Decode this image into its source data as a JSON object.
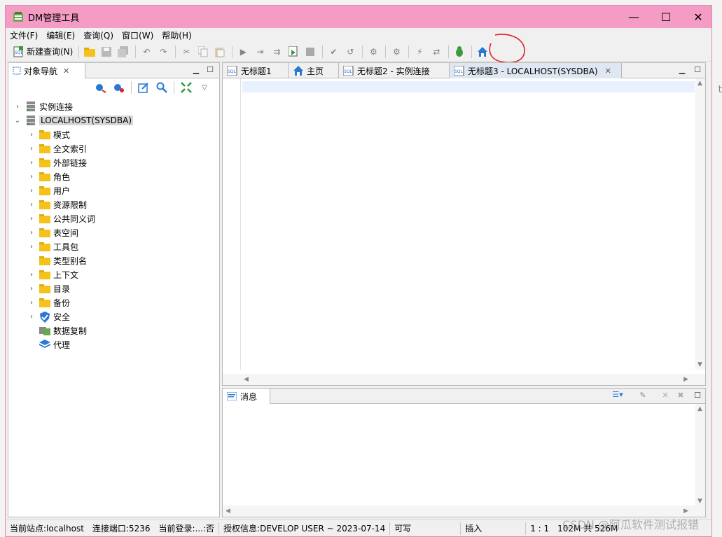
{
  "window": {
    "title": "DM管理工具",
    "minimize": "—",
    "maximize": "☐",
    "close": "✕"
  },
  "menu": [
    "文件(F)",
    "编辑(E)",
    "查询(Q)",
    "窗口(W)",
    "帮助(H)"
  ],
  "toolbar": {
    "new_query": "新建查询(N)"
  },
  "navigator": {
    "tab_label": "对象导航",
    "tree": [
      {
        "label": "实例连接",
        "level": 0,
        "expanded": false,
        "icon": "server-icon"
      },
      {
        "label": "LOCALHOST(SYSDBA)",
        "level": 0,
        "expanded": true,
        "icon": "server-icon",
        "selected": true
      },
      {
        "label": "模式",
        "level": 1,
        "icon": "folder-icon"
      },
      {
        "label": "全文索引",
        "level": 1,
        "icon": "folder-icon"
      },
      {
        "label": "外部链接",
        "level": 1,
        "icon": "folder-icon"
      },
      {
        "label": "角色",
        "level": 1,
        "icon": "folder-icon"
      },
      {
        "label": "用户",
        "level": 1,
        "icon": "folder-icon"
      },
      {
        "label": "资源限制",
        "level": 1,
        "icon": "folder-icon"
      },
      {
        "label": "公共同义词",
        "level": 1,
        "icon": "folder-icon"
      },
      {
        "label": "表空间",
        "level": 1,
        "icon": "folder-icon"
      },
      {
        "label": "工具包",
        "level": 1,
        "icon": "folder-icon"
      },
      {
        "label": "类型别名",
        "level": 1,
        "icon": "folder-icon",
        "noarrow": true
      },
      {
        "label": "上下文",
        "level": 1,
        "icon": "folder-icon"
      },
      {
        "label": "目录",
        "level": 1,
        "icon": "folder-icon"
      },
      {
        "label": "备份",
        "level": 1,
        "icon": "folder-icon"
      },
      {
        "label": "安全",
        "level": 1,
        "icon": "shield-icon"
      },
      {
        "label": "数据复制",
        "level": 1,
        "icon": "replication-icon",
        "noarrow": true
      },
      {
        "label": "代理",
        "level": 1,
        "icon": "agent-icon",
        "noarrow": true
      }
    ]
  },
  "editor_tabs": [
    {
      "label": "无标题1",
      "icon": "sql-icon"
    },
    {
      "label": "主页",
      "icon": "home-icon"
    },
    {
      "label": "无标题2 - 实例连接",
      "icon": "sql-icon"
    },
    {
      "label": "无标题3 - LOCALHOST(SYSDBA)",
      "icon": "sql-icon",
      "active": true
    }
  ],
  "messages": {
    "tab_label": "消息"
  },
  "status": {
    "site": "当前站点:localhost",
    "port": "连接端口:5236",
    "login": "当前登录:...:否",
    "license": "授权信息:DEVELOP USER ~ 2023-07-14",
    "writable": "可写",
    "insert": "插入",
    "position": "1 : 1",
    "memory": "102M 共 526M"
  },
  "watermark": "CSDN @阿瓜软件测试报错",
  "colors": {
    "titlebar": "#f59cc4",
    "folder": "#f4c21b",
    "home": "#2a78d6",
    "annotation": "#e0202a"
  }
}
